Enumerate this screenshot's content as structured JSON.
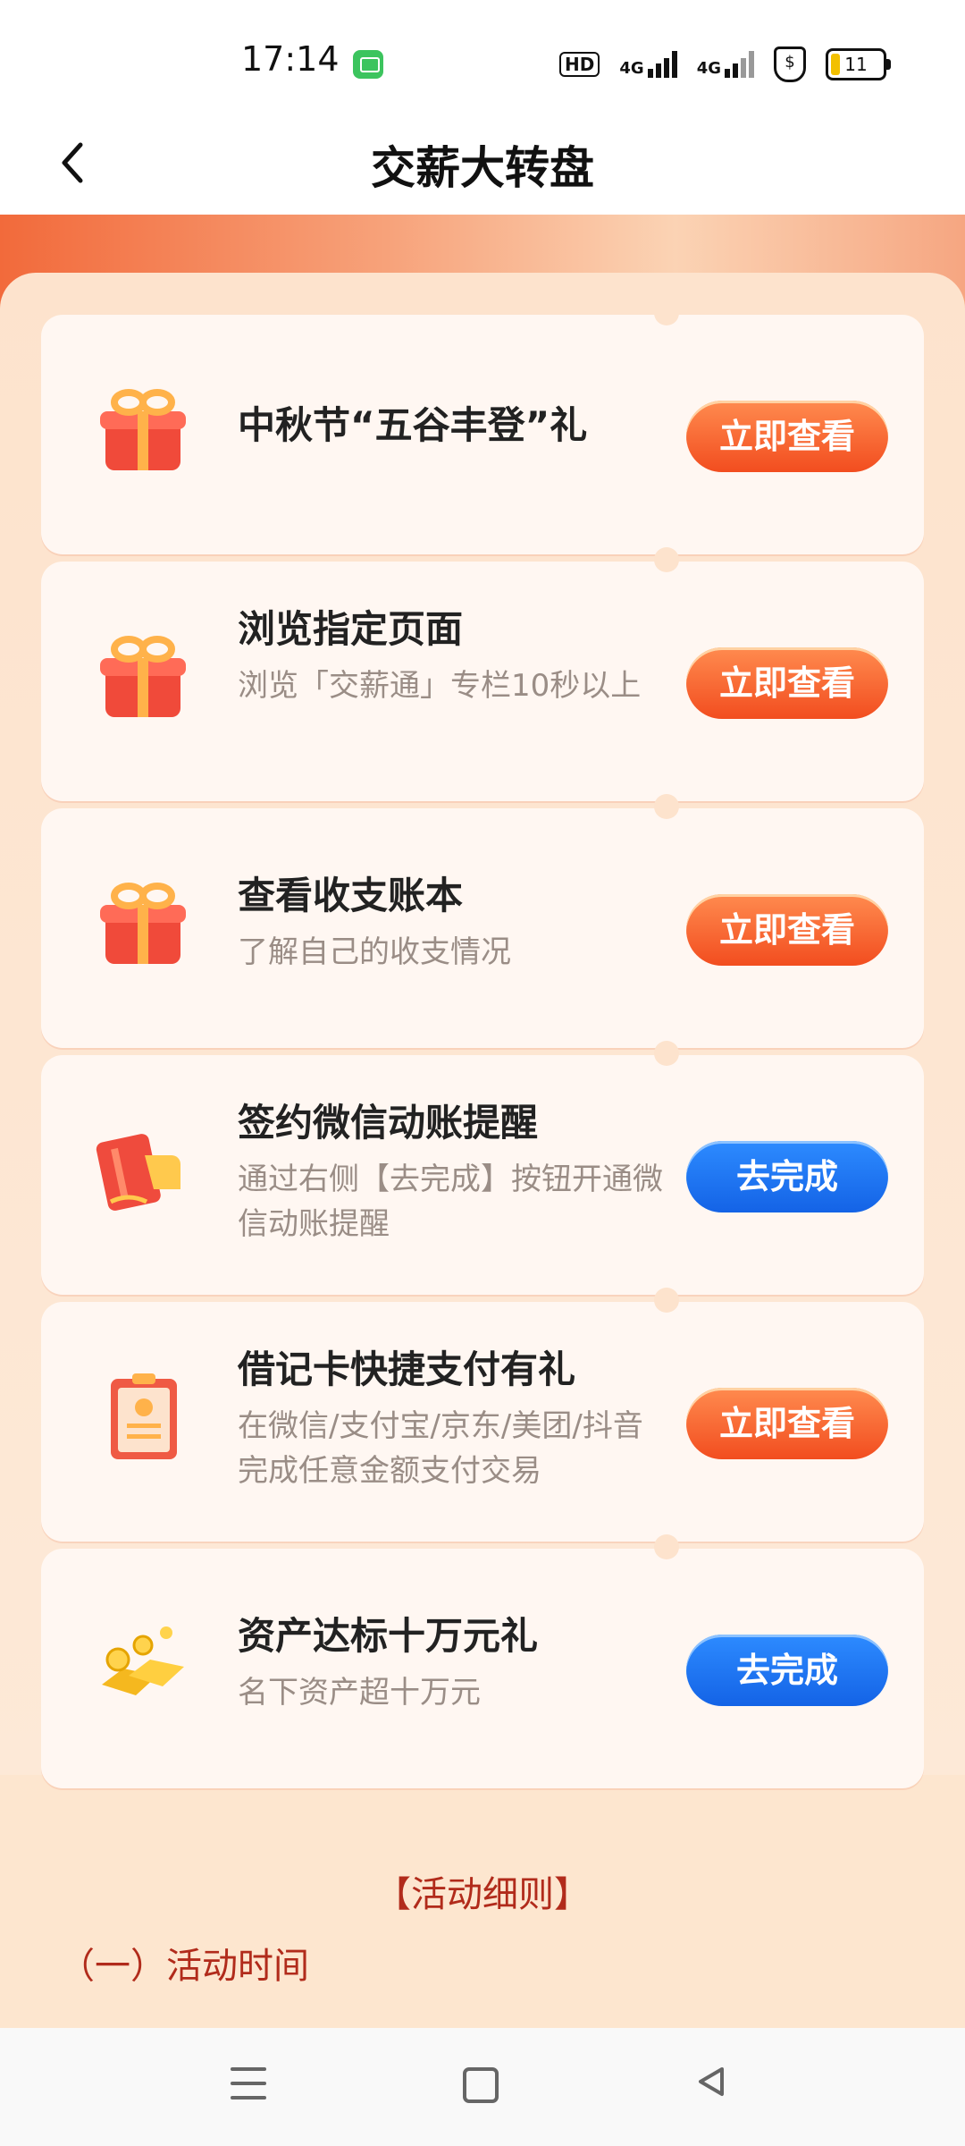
{
  "status_bar": {
    "time": "17:14",
    "network_hd": "HD",
    "network_1": "4G",
    "network_2": "4G",
    "battery": "11"
  },
  "header": {
    "title": "交薪大转盘"
  },
  "tasks": [
    {
      "name": "中秋节“五谷丰登”礼",
      "desc": "",
      "button": "立即查看",
      "button_color": "orange",
      "icon": "gift-icon"
    },
    {
      "name": "浏览指定页面",
      "desc": "浏览「交薪通」专栏10秒以上",
      "button": "立即查看",
      "button_color": "orange",
      "icon": "gift-icon"
    },
    {
      "name": "查看收支账本",
      "desc": "了解自己的收支情况",
      "button": "立即查看",
      "button_color": "orange",
      "icon": "gift-icon"
    },
    {
      "name": "签约微信动账提醒",
      "desc": "通过右侧【去完成】按钮开通微信动账提醒",
      "button": "去完成",
      "button_color": "blue",
      "icon": "card-icon"
    },
    {
      "name": "借记卡快捷支付有礼",
      "desc": "在微信/支付宝/京东/美团/抖音完成任意金额支付交易",
      "button": "立即查看",
      "button_color": "orange",
      "icon": "clipboard-icon"
    },
    {
      "name": "资产达标十万元礼",
      "desc": "名下资产超十万元",
      "button": "去完成",
      "button_color": "blue",
      "icon": "gold-bars-icon"
    }
  ],
  "rules": {
    "title": "【活动细则】",
    "section_1": "（一）活动时间"
  },
  "colors": {
    "orange": "#f4602a",
    "blue": "#1c72f0",
    "rule_red": "#b12b1b"
  }
}
